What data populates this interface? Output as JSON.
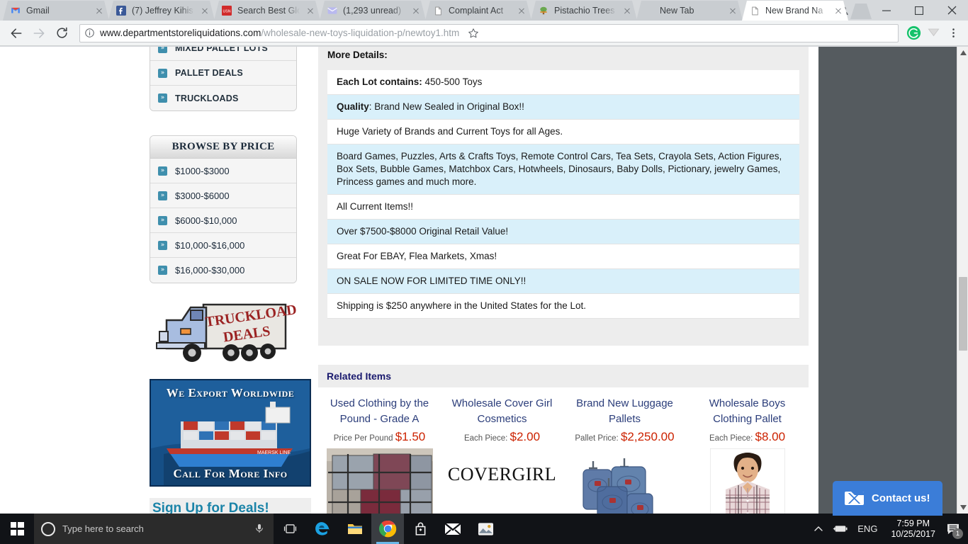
{
  "browser": {
    "tabs": [
      {
        "title": "Gmail",
        "favicon": "gmail-icon",
        "active": false
      },
      {
        "title": "(7) Jeffrey Kihis",
        "favicon": "facebook-icon",
        "active": false
      },
      {
        "title": "Search Best Glo",
        "favicon": "usn-icon",
        "active": false
      },
      {
        "title": "(1,293 unread)",
        "favicon": "mail-icon",
        "active": false
      },
      {
        "title": "Complaint Act",
        "favicon": "page-icon",
        "active": false
      },
      {
        "title": "Pistachio Trees",
        "favicon": "tree-icon",
        "active": false
      },
      {
        "title": "New Tab",
        "favicon": "none",
        "active": false
      },
      {
        "title": "New Brand Na",
        "favicon": "page-icon",
        "active": true
      }
    ],
    "url_domain": "www.departmentstoreliquidations.com",
    "url_path": "/wholesale-new-toys-liquidation-p/newtoy1.htm",
    "toolbar_icons": [
      "back-icon",
      "forward-icon",
      "reload-icon",
      "site-info-icon",
      "bookmark-star-icon",
      "grammarly-icon",
      "extension-icon",
      "chrome-menu-icon"
    ],
    "window_controls": [
      "profile-icon",
      "minimize-icon",
      "maximize-icon",
      "close-icon"
    ]
  },
  "sidebar": {
    "nav_items": [
      {
        "label": "MIXED PALLET LOTS"
      },
      {
        "label": "PALLET DEALS"
      },
      {
        "label": "TRUCKLOADS"
      }
    ],
    "price_header": "BROWSE BY PRICE",
    "price_items": [
      {
        "label": "$1000-$3000"
      },
      {
        "label": "$3000-$6000"
      },
      {
        "label": "$6000-$10,000"
      },
      {
        "label": "$10,000-$16,000"
      },
      {
        "label": "$16,000-$30,000"
      }
    ],
    "truck_ad": {
      "line1": "TRUCKLOAD",
      "line2": "DEALS"
    },
    "ship_ad": {
      "top": "We Export Worldwide",
      "bottom": "Call For More Info",
      "ship_name": "MAERSK LINE"
    },
    "signup": "Sign Up for Deals!"
  },
  "main": {
    "more_details_label": "More Details:",
    "detail_rows": [
      {
        "bold": "Each Lot contains:",
        "text": " 450-500 Toys"
      },
      {
        "bold": "Quality",
        "text": ":  Brand New Sealed in Original Box!!"
      },
      {
        "bold": "",
        "text": "Huge Variety of Brands and Current Toys for all Ages."
      },
      {
        "bold": "",
        "text": "Board Games, Puzzles, Arts & Crafts Toys, Remote Control Cars, Tea Sets, Crayola Sets, Action Figures, Box Sets, Bubble Games, Matchbox Cars, Hotwheels, Dinosaurs, Baby Dolls, Pictionary, jewelry Games, Princess games and much more."
      },
      {
        "bold": "",
        "text": "All Current Items!!"
      },
      {
        "bold": "",
        "text": "Over $7500-$8000 Original Retail Value!"
      },
      {
        "bold": "",
        "text": "Great For EBAY, Flea Markets, Xmas!"
      },
      {
        "bold": "",
        "text": "ON SALE NOW FOR LIMITED TIME ONLY!!"
      },
      {
        "bold": "",
        "text": "Shipping is $250 anywhere in the United States for the Lot."
      }
    ],
    "related_heading": "Related Items",
    "related_items": [
      {
        "title": "Used Clothing by the Pound - Grade A",
        "price_label": "Price Per Pound",
        "price": "$1.50",
        "image": "clothing-bale-image"
      },
      {
        "title": "Wholesale Cover Girl Cosmetics",
        "price_label": "Each Piece:",
        "price": "$2.00",
        "image": "covergirl-logo-image",
        "logo_text": "COVERGIRL"
      },
      {
        "title": "Brand New Luggage Pallets",
        "price_label": "Pallet Price:",
        "price": "$2,250.00",
        "image": "luggage-set-image"
      },
      {
        "title": "Wholesale Boys Clothing Pallet",
        "price_label": "Each Piece:",
        "price": "$8.00",
        "image": "boy-model-image"
      }
    ]
  },
  "widget": {
    "contact_label": "Contact us!"
  },
  "taskbar": {
    "search_placeholder": "Type here to search",
    "icons": [
      "task-view-icon",
      "edge-icon",
      "file-explorer-icon",
      "chrome-icon",
      "store-icon",
      "mail-icon",
      "photos-icon"
    ],
    "tray": {
      "chevron": "show-hidden-icons",
      "battery": "battery-icon",
      "language": "ENG",
      "time": "7:59 PM",
      "date": "10/25/2017",
      "notification_count": "1"
    }
  },
  "colors": {
    "accent_blue": "#3b7dd8",
    "bullet_teal": "#3f8fad",
    "price_red": "#cc2200",
    "link_navy": "#2b3d7a",
    "row_highlight": "#d9f0fa"
  }
}
